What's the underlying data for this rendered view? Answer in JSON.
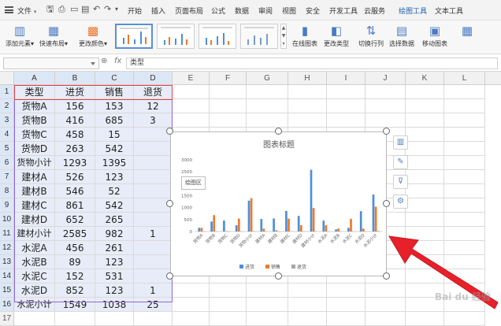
{
  "menubar": {
    "file": "文件",
    "tabs": [
      "开始",
      "插入",
      "页面布局",
      "公式",
      "数据",
      "审阅",
      "视图",
      "安全",
      "开发工具",
      "云服务",
      "绘图工具",
      "文本工具"
    ]
  },
  "ribbon": {
    "add_element": "添加元素",
    "quick_layout": "快速布局",
    "change_color": "更改颜色",
    "online_chart": "在线图表",
    "change_type": "更改类型",
    "switch_row_col": "切换行列",
    "select_data": "选择数据",
    "move_chart": "移动图表"
  },
  "formula_bar": {
    "fx": "fx",
    "value": "类型"
  },
  "sheet": {
    "columns": [
      "A",
      "B",
      "C",
      "D",
      "E",
      "F",
      "G",
      "H",
      "I",
      "J",
      "K",
      "L"
    ],
    "rows": [
      [
        "类型",
        "进货",
        "销售",
        "退货"
      ],
      [
        "货物A",
        "156",
        "153",
        "12"
      ],
      [
        "货物B",
        "416",
        "685",
        "3"
      ],
      [
        "货物C",
        "458",
        "15",
        ""
      ],
      [
        "货物D",
        "263",
        "542",
        ""
      ],
      [
        "货物小计",
        "1293",
        "1395",
        ""
      ],
      [
        "建材A",
        "526",
        "123",
        ""
      ],
      [
        "建材B",
        "546",
        "52",
        ""
      ],
      [
        "建材C",
        "861",
        "542",
        ""
      ],
      [
        "建材D",
        "652",
        "265",
        ""
      ],
      [
        "建材小计",
        "2585",
        "982",
        "1"
      ],
      [
        "水泥A",
        "456",
        "261",
        ""
      ],
      [
        "水泥B",
        "89",
        "123",
        ""
      ],
      [
        "水泥C",
        "152",
        "531",
        ""
      ],
      [
        "水泥D",
        "852",
        "123",
        "1"
      ],
      [
        "水泥小计",
        "1549",
        "1038",
        "25"
      ]
    ]
  },
  "chart_data": {
    "type": "bar",
    "title": "图表标题",
    "plot_area_label": "绘图区",
    "categories": [
      "货物A",
      "货物B",
      "货物C",
      "货物D",
      "货物小计",
      "建材A",
      "建材B",
      "建材C",
      "建材D",
      "建材小计",
      "水泥A",
      "水泥B",
      "水泥C",
      "水泥D",
      "水泥小计"
    ],
    "series": [
      {
        "name": "进货",
        "color": "#4e8fd6",
        "values": [
          156,
          416,
          458,
          263,
          1293,
          526,
          546,
          861,
          652,
          2585,
          456,
          89,
          152,
          852,
          1549
        ]
      },
      {
        "name": "销售",
        "color": "#ec7a2d",
        "values": [
          153,
          685,
          15,
          542,
          1395,
          123,
          52,
          542,
          265,
          982,
          261,
          123,
          531,
          123,
          1038
        ]
      },
      {
        "name": "退货",
        "color": "#a5a5a5",
        "values": [
          12,
          3,
          5,
          6,
          20,
          8,
          7,
          9,
          6,
          15,
          7,
          4,
          5,
          1,
          25
        ]
      }
    ],
    "ylim": [
      0,
      3000
    ],
    "yticks": [
      0,
      500,
      1000,
      1500,
      2000,
      2500,
      3000
    ],
    "legend": "bottom",
    "grid": false
  },
  "watermark": "Bai du 经验"
}
